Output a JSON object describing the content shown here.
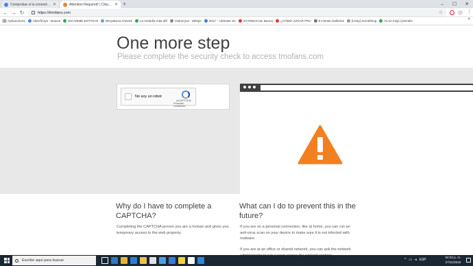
{
  "tabs": [
    {
      "title": "Comprobar si la conexión de un",
      "active": false
    },
    {
      "title": "Attention Required! | Cloudflare",
      "active": true
    }
  ],
  "newtab_symbol": "+",
  "window_controls": {
    "minimize": "–",
    "maximize": "☐",
    "close": "✕"
  },
  "address": {
    "url": "https://tmofans.com"
  },
  "nav": {
    "back": "←",
    "forward": "→",
    "reload": "↻",
    "star": "☆",
    "menu": "⋮"
  },
  "bookmarks": [
    {
      "label": "Aplicaciones",
      "icon": "apps-icon",
      "color": "#5f6368"
    },
    {
      "label": "Abierfil.sys - Buscar",
      "icon": "google-icon",
      "color": "#4285f4"
    },
    {
      "label": "EN ANIME ESTÁN M",
      "icon": "site-icon",
      "color": "#34a853"
    },
    {
      "label": "Wizyakuza Artwork",
      "icon": "site-icon",
      "color": "#7b9fc9"
    },
    {
      "label": "La melodía más difí",
      "icon": "site-icon",
      "color": "#34a853"
    },
    {
      "label": "Galneryus - Wikipe",
      "icon": "site-icon",
      "color": "#888888"
    },
    {
      "label": "2017 – Ultimate Se",
      "icon": "site-icon",
      "color": "#3b7dd8"
    },
    {
      "label": "20 RIMAS tan Buena",
      "icon": "site-icon",
      "color": "#e53935"
    },
    {
      "label": "¿CÓMO JUGAR FRU",
      "icon": "site-icon",
      "color": "#e53935"
    },
    {
      "label": "E-Hentai Galleries",
      "icon": "site-icon",
      "color": "#777777"
    },
    {
      "label": "[Unity] Something",
      "icon": "site-icon",
      "color": "#999999"
    },
    {
      "label": "Ya se mojó (Literalm",
      "icon": "site-icon",
      "color": "#34a853"
    }
  ],
  "bookmarks_more": "»",
  "page": {
    "title": "One more step",
    "subtitle": "Please complete the security check to access tmofans.com",
    "captcha": {
      "label": "No soy un robot",
      "brand": "reCAPTCHA",
      "terms": "Privacidad - Condiciones"
    },
    "q1": "Why do I have to complete a CAPTCHA?",
    "a1": "Completing the CAPTCHA proves you are a human and gives you temporary access to the web property.",
    "q2": "What can I do to prevent this in the future?",
    "a2": "If you are on a personal connection, like at home, you can run an anti-virus scan on your device to make sure it is not infected with malware.",
    "a3": "If you are at an office or shared network, you can ask the network administrator to run a scan across the network looking"
  },
  "colors": {
    "warning": "#f38020",
    "hero_title": "#404040",
    "grey_band": "#e8e8e8"
  },
  "taskbar": {
    "search_placeholder": "Escribe aquí para buscar",
    "apps": [
      {
        "name": "task-view-icon",
        "color": "#ffffff"
      },
      {
        "name": "edge-icon",
        "color": "#3277bc"
      },
      {
        "name": "chrome-icon",
        "color": "#e8b23a",
        "active": true
      },
      {
        "name": "store-icon",
        "color": "#2d7dd2"
      },
      {
        "name": "explorer-icon",
        "color": "#f0c24b"
      },
      {
        "name": "media-icon",
        "color": "#e0e0e0"
      },
      {
        "name": "gallery-icon",
        "color": "#4aa3df"
      },
      {
        "name": "game-icon",
        "color": "#3a7bd5"
      },
      {
        "name": "sticky-icon",
        "color": "#f4d03f"
      },
      {
        "name": "app-icon",
        "color": "#ffffff"
      },
      {
        "name": "mail-icon",
        "color": "#2b88d8"
      }
    ],
    "tray_language": "ESP",
    "time": "04:02 p. m.",
    "date": "27/11/2018"
  }
}
